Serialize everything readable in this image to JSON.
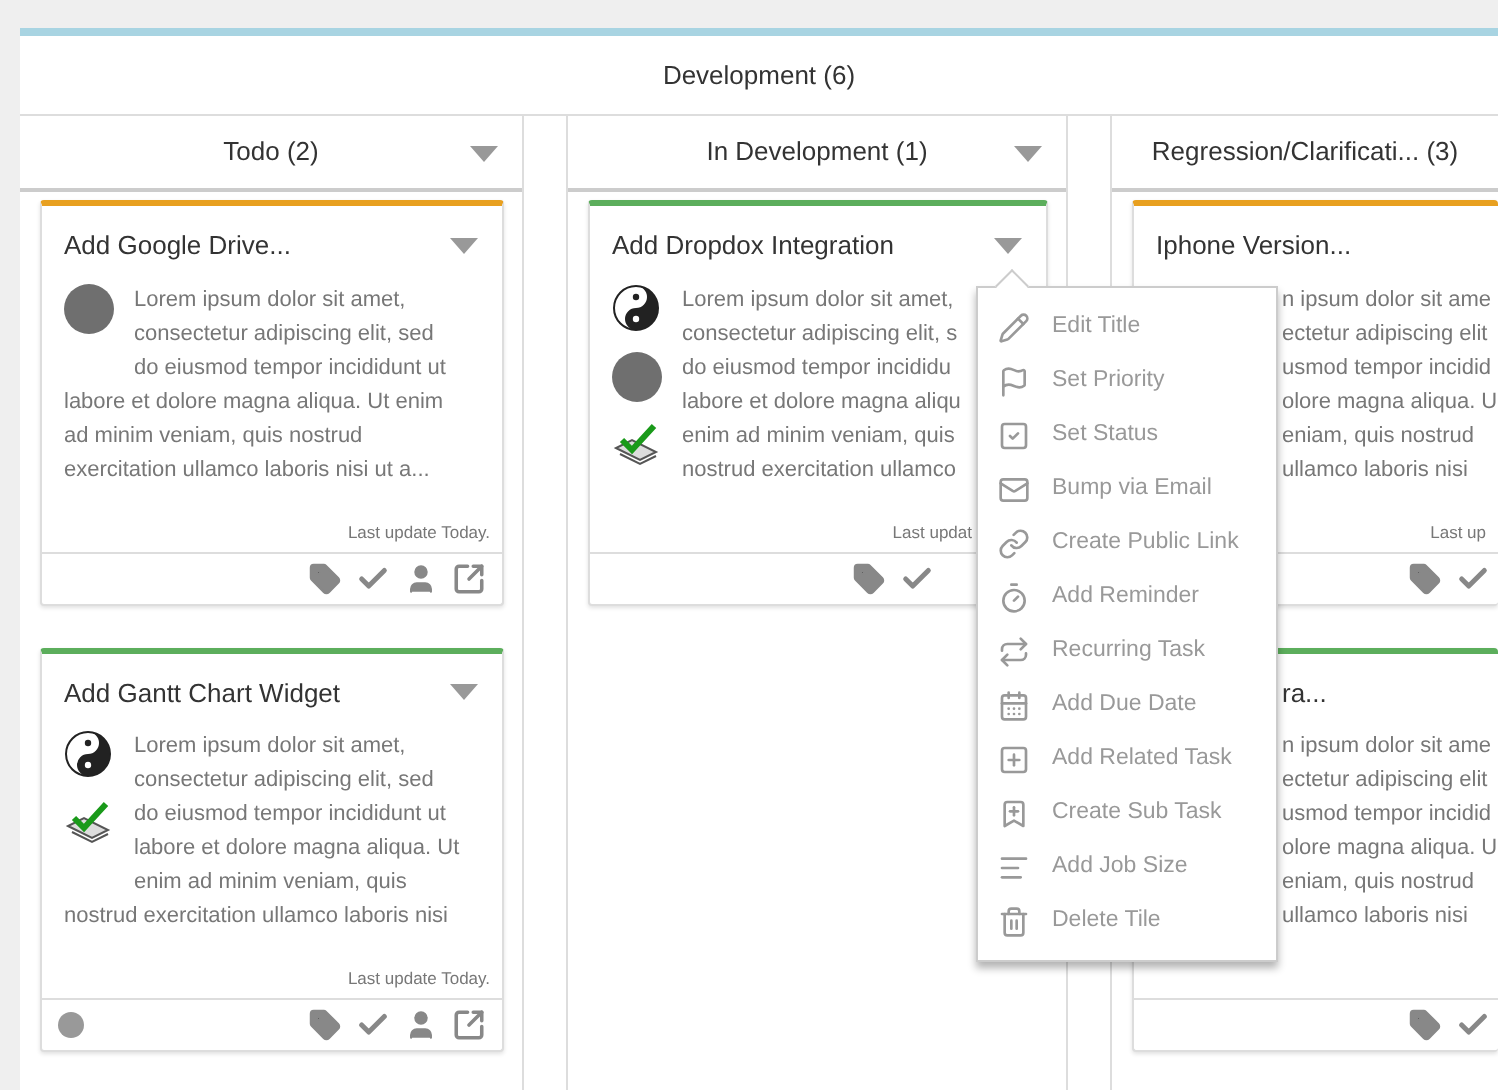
{
  "board": {
    "title": "Development (6)"
  },
  "columns": [
    {
      "title": "Todo (2)",
      "menu_button": true,
      "cards": [
        {
          "kind": "full",
          "title": "Add Google Drive...",
          "color": "#e8a020",
          "avatars": [
            {
              "kind": "photo"
            }
          ],
          "lines": [
            "Lorem ipsum dolor sit amet,",
            "consectetur adipiscing elit, sed",
            "do eiusmod tempor incididunt ut",
            "labore et dolore magna aliqua. Ut enim",
            "ad minim veniam, quis nostrud",
            "exercitation ullamco laboris nisi ut a..."
          ],
          "updated": "Last update Today."
        },
        {
          "kind": "full",
          "title": "Add Gantt Chart Widget",
          "color": "#5cae5c",
          "avatars": [
            {
              "kind": "yin-yang"
            },
            {
              "kind": "checklist"
            }
          ],
          "lines": [
            "Lorem ipsum dolor sit amet,",
            "consectetur adipiscing elit, sed",
            "do eiusmod tempor incididunt ut",
            "labore et dolore magna aliqua. Ut",
            "enim ad minim veniam, quis",
            "nostrud exercitation ullamco laboris nisi"
          ],
          "updated": "Last update Today.",
          "status_dot": true
        }
      ]
    },
    {
      "title": "In Development (1)",
      "menu_button": true,
      "cards": [
        {
          "kind": "menu_open",
          "title": "Add Dropdox Integration",
          "color": "#5cae5c",
          "avatars": [
            {
              "kind": "yin-yang"
            },
            {
              "kind": "photo"
            },
            {
              "kind": "checklist"
            }
          ],
          "lines": [
            "Lorem ipsum dolor sit amet,",
            "consectetur adipiscing elit, s",
            "do eiusmod tempor incididu",
            "labore et dolore magna aliqu",
            "enim ad minim veniam, quis",
            "nostrud exercitation ullamco"
          ],
          "updated": "Last updat",
          "menu": {
            "expanded": true,
            "items": [
              "Edit Title",
              "Set Priority",
              "Set Status",
              "Bump via Email",
              "Create Public Link",
              "Add Reminder",
              "Recurring Task",
              "Add Due Date",
              "Add Related Task",
              "Create Sub Task",
              "Add Job Size",
              "Delete Tile"
            ]
          }
        }
      ]
    },
    {
      "title": "Regression/Clarificati... (3)",
      "cards": [
        {
          "kind": "partly_covered",
          "title": "Iphone Version...",
          "color": "#e8a020",
          "lines": [
            "n ipsum dolor sit ame",
            "ectetur adipiscing elit",
            "usmod tempor incidid",
            "olore magna aliqua. U",
            "eniam, quis nostrud",
            "ullamco laboris nisi"
          ],
          "updated": "Last up"
        },
        {
          "kind": "mostly_covered",
          "title": "ra...",
          "color": "#5cae5c",
          "lines": [
            "n ipsum dolor sit ame",
            "ectetur adipiscing elit",
            "usmod tempor incidid",
            "olore magna aliqua. U",
            "eniam, quis nostrud",
            "ullamco laboris nisi"
          ]
        }
      ]
    }
  ]
}
